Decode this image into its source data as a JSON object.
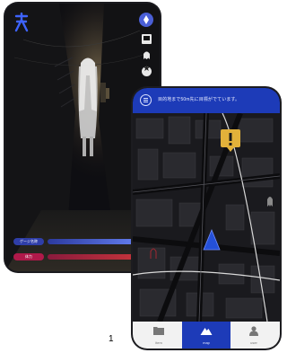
{
  "left_screen": {
    "meters": [
      {
        "label": "ゲージ名称",
        "label_color": "#2f3ea8",
        "track_color_from": "#2c3a9e",
        "track_color_to": "#6f8cff"
      },
      {
        "label": "体力",
        "label_color": "#b0194a",
        "track_color_from": "#8a1a3d",
        "track_color_to": "#d13a3a"
      }
    ],
    "icons": [
      "app-logo-icon",
      "compass-icon",
      "camera-icon",
      "ghost-icon",
      "star-icon"
    ]
  },
  "right_screen": {
    "header_text": "目的地まで50m先に目標がでています。",
    "nav": [
      {
        "label": "item",
        "icon": "folder-icon",
        "active": false
      },
      {
        "label": "map",
        "icon": "mountain-icon",
        "active": true
      },
      {
        "label": "user",
        "icon": "person-icon",
        "active": false
      }
    ]
  },
  "page_number": "1",
  "colors": {
    "accent_blue": "#1d3bb8",
    "alert_yellow": "#e2b13a",
    "player_marker": "#2450d8"
  }
}
